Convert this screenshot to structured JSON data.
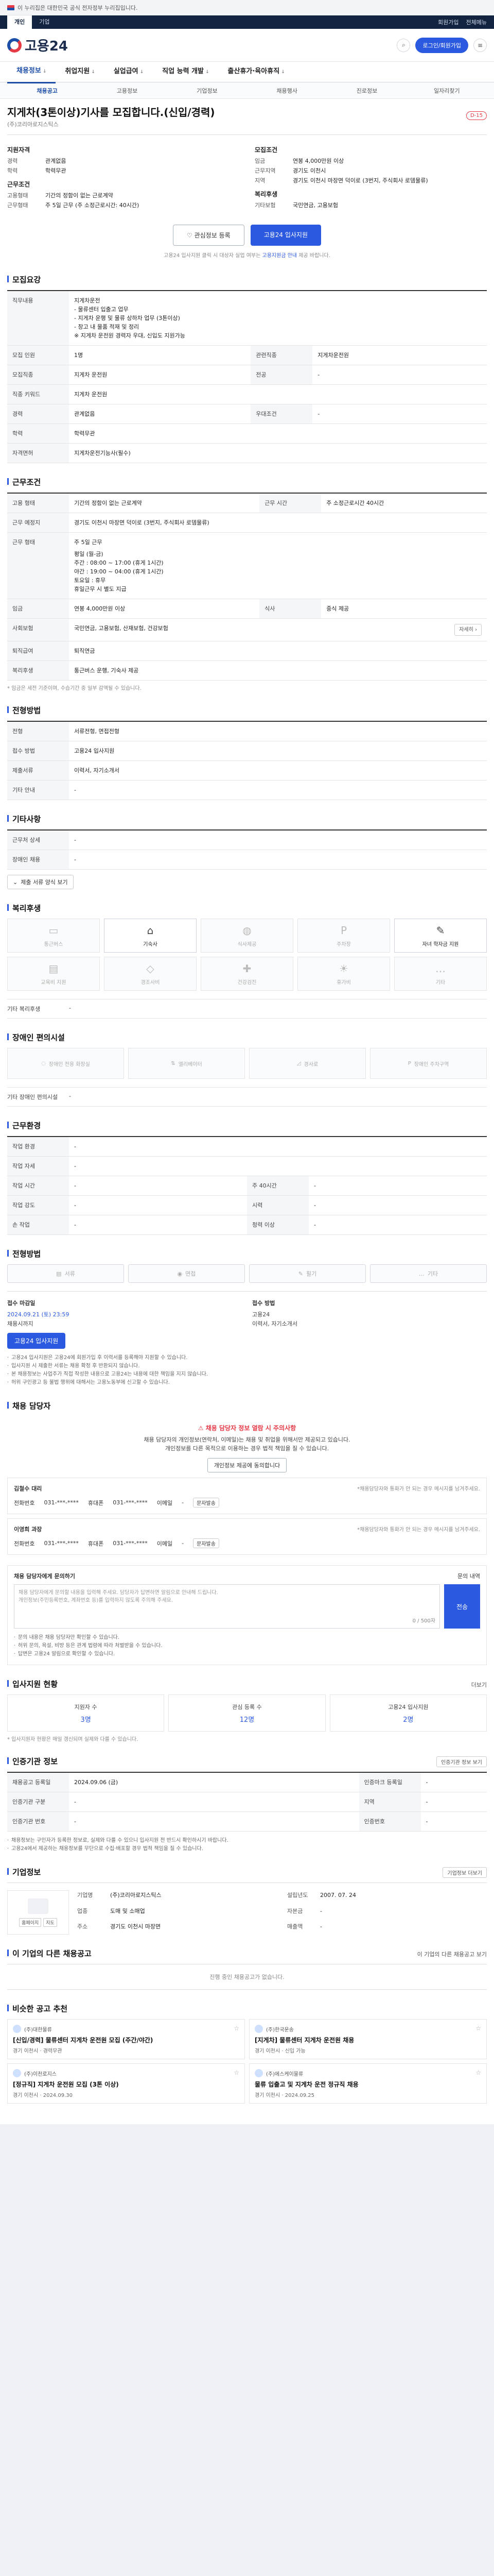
{
  "gov_banner": "이 누리집은 대한민국 공식 전자정부 누리집입니다.",
  "util": {
    "tabs": [
      "개인",
      "기업"
    ],
    "links": [
      "회원가입",
      "전체메뉴"
    ]
  },
  "header": {
    "logo": "고용24",
    "login": "로그인/회원가입"
  },
  "gnb": [
    {
      "label": "채용정보",
      "sub": "↓"
    },
    {
      "label": "취업지원",
      "sub": "↓"
    },
    {
      "label": "실업급여",
      "sub": "↓"
    },
    {
      "label": "직업 능력 개발",
      "sub": "↓"
    },
    {
      "label": "출산휴가·육아휴직",
      "sub": "↓"
    }
  ],
  "subnav": [
    "채용공고",
    "고용정보",
    "기업정보",
    "채용행사",
    "진로정보",
    "일자리찾기"
  ],
  "job": {
    "title": "지게차(3톤이상)기사를 모집합니다.(신입/경력)",
    "d_badge": "D-15",
    "company": "(주)코리아로지스틱스"
  },
  "summary": {
    "left_group1": "지원자격",
    "left": [
      {
        "k": "경력",
        "v": "관계없음"
      },
      {
        "k": "학력",
        "v": "학력무관"
      }
    ],
    "left_group2": "근무조건",
    "left2": [
      {
        "k": "고용형태",
        "v": "기간의 정함이 없는 근로계약"
      },
      {
        "k": "근무형태",
        "v": "주 5일 근무 (주 소정근로시간: 40시간)"
      }
    ],
    "right_group1": "모집조건",
    "right": [
      {
        "k": "임금",
        "v": "연봉 4,000만원 이상"
      },
      {
        "k": "근무지역",
        "v": "경기도 이천시"
      },
      {
        "k": "지역",
        "v": "경기도 이천시 마장면 덕이로 (3번지, 주식회사 로뎀물류)"
      }
    ],
    "right_group2": "복리후생",
    "right2": [
      {
        "k": "기타보험",
        "v": "국민연금, 고용보험"
      }
    ]
  },
  "actions": {
    "scrap": "관심정보 등록",
    "apply": "고용24 입사지원"
  },
  "notice": {
    "text": "고용24 입사지원 클릭 시 대상자 실업 여부는",
    "link": "고용지원금 안내",
    "text2": "제공 바랍니다."
  },
  "s_recruit": {
    "title": "모집요강",
    "rows": [
      {
        "k": "직무내용",
        "v": "지게차운전\n- 물류센터 입출고 업무\n- 지게차 운행 및 물류 상하차 업무 (3톤이상)\n- 창고 내 물품 적재 및 정리\n※ 지게차 운전원 경력자 우대, 신입도 지원가능"
      },
      {
        "k": "모집 인원",
        "v": "1명"
      },
      {
        "k": "모집직종",
        "v": "지게차 운전원"
      },
      {
        "k": "직종 키워드",
        "v": "지게차 운전원"
      },
      {
        "k": "경력",
        "v": "관계없음"
      },
      {
        "k": "학력",
        "v": "학력무관"
      },
      {
        "k": "자격면허",
        "v": "지게차운전기능사(필수)"
      }
    ],
    "side": [
      {
        "k": "관련직종",
        "v": "지게차운전원"
      },
      {
        "k": "전공",
        "v": "-"
      },
      {
        "k": "우대조건",
        "v": "-"
      }
    ]
  },
  "s_work": {
    "title": "근무조건",
    "rows": [
      {
        "k": "고용 형태",
        "v": "기간의 정함이 없는 근로계약"
      },
      {
        "k": "근무 시간",
        "v": "주 소정근로시간 40시간"
      },
      {
        "k": "근무 예정지",
        "v": "경기도 이천시 마장면 덕이로 (3번지, 주식회사 로뎀물류)"
      },
      {
        "k": "근무 형태",
        "v": "주 5일 근무"
      },
      {
        "k": "사회보험",
        "v": "국민연금, 고용보험, 산재보험, 건강보험"
      },
      {
        "k": "퇴직급여",
        "v": "퇴직연금"
      }
    ],
    "schedule": "평일 (월-금)\n주간 : 08:00 ~ 17:00 (휴게 1시간)\n야간 : 19:00 ~ 04:00 (휴게 1시간)\n토요일 : 휴무\n휴일근무 시 별도 지급",
    "wage": "연봉 4,000만원 이상",
    "meal": "중식 제공",
    "welfare": "통근버스 운행, 기숙사 제공",
    "footnote": "* 임금은 세전 기준이며, 수습기간 중 일부 감액될 수 있습니다."
  },
  "s_apply_period": {
    "title": "전형방법",
    "rows": [
      {
        "k": "전형",
        "v": "서류전형, 면접전형"
      },
      {
        "k": "접수 방법",
        "v": "고용24 입사지원"
      },
      {
        "k": "제출서류",
        "v": "이력서, 자기소개서"
      },
      {
        "k": "기타 안내",
        "v": "-"
      }
    ],
    "toggle": "제출 서류 양식 보기"
  },
  "s_etc": {
    "title": "기타사항",
    "rows": [
      {
        "k": "근무처 상세",
        "v": "-"
      },
      {
        "k": "장애인 채용",
        "v": "-"
      }
    ]
  },
  "s_welfare": {
    "title": "복리후생",
    "cells": [
      "통근버스",
      "기숙사",
      "식사제공",
      "주차장",
      "자녀 학자금 지원",
      "교육비 지원",
      "경조사비",
      "건강검진",
      "휴가비",
      "기타"
    ],
    "on_index": [
      1,
      4
    ],
    "etc_label": "기타 복리후생",
    "etc_value": "-"
  },
  "s_disabled": {
    "title": "장애인 편의시설",
    "cells": [
      "장애인 전용 화장실",
      "엘리베이터",
      "경사로",
      "장애인 주차구역"
    ],
    "etc_label": "기타 장애인 편의시설",
    "etc_value": "-"
  },
  "s_place": {
    "title": "근무환경",
    "rows": [
      {
        "k": "작업 환경",
        "v": "-",
        "k2": "",
        "v2": ""
      },
      {
        "k": "작업 자세",
        "v": "-",
        "k2": "",
        "v2": ""
      },
      {
        "k": "작업 시간",
        "v": "-",
        "k2": "주 40시간",
        "v2": "-"
      },
      {
        "k": "작업 강도",
        "v": "-",
        "k2": "시력",
        "v2": "-"
      },
      {
        "k": "손 작업",
        "v": "-",
        "k2": "청력 이상",
        "v2": "-"
      }
    ]
  },
  "s_method": {
    "title": "전형방법",
    "btns": [
      "서류",
      "면접",
      "필기",
      "기타"
    ],
    "cols": [
      {
        "k": "접수 마감일",
        "v": "2024.09.21 (토) 23:59",
        "s": "채용시까지"
      },
      {
        "k": "접수 방법",
        "v": "고용24",
        "s": "이력서, 자기소개서"
      }
    ],
    "btn": "고용24 입사지원",
    "bullets": [
      "고용24 입사지원은 고용24에 회원가입 후 이력서를 등록해야 지원할 수 있습니다.",
      "입사지원 시 제출한 서류는 채용 확정 후 반환되지 않습니다.",
      "본 채용정보는 사업주가 직접 작성한 내용으로 고용24는 내용에 대한 책임을 지지 않습니다.",
      "허위 구인광고 등 불법 행위에 대해서는 고용노동부에 신고할 수 있습니다."
    ]
  },
  "s_contact": {
    "title": "채용 담당자",
    "warn": "채용 담당자 정보 열람 시 주의사항",
    "text": "채용 담당자의 개인정보(연락처, 이메일)는 채용 및 취업을 위해서만 제공되고 있습니다.\n개인정보를 다른 목적으로 이용하는 경우 법적 책임을 질 수 있습니다.",
    "btn": "개인정보 제공에 동의합니다",
    "people": [
      {
        "name": "김철수 대리",
        "sub": "*채용담당자와 통화가 안 되는 경우 메시지를 남겨주세요.",
        "phone": "031-***-****",
        "tel_label": "휴대폰",
        "fax": "031-***-****",
        "mail_label": "이메일",
        "mail": "-",
        "pill": "문자발송"
      },
      {
        "name": "이영희 과장",
        "sub": "*채용담당자와 통화가 안 되는 경우 메시지를 남겨주세요.",
        "phone": "031-***-****",
        "tel_label": "휴대폰",
        "fax": "031-***-****",
        "mail_label": "이메일",
        "mail": "-",
        "pill": "문자발송"
      }
    ]
  },
  "s_inquiry": {
    "label": "채용 담당자에게 문의하기",
    "more": "문의 내역",
    "placeholder": "채용 담당자에게 문의할 내용을 입력해 주세요. 담당자가 답변하면 알림으로 안내해 드립니다.\n개인정보(주민등록번호, 계좌번호 등)를 입력하지 않도록 주의해 주세요.",
    "count": "0 / 500자",
    "send": "전송",
    "bullets": [
      "문의 내용은 채용 담당자만 확인할 수 있습니다.",
      "허위 문의, 욕설, 비방 등은 관계 법령에 따라 처벌받을 수 있습니다.",
      "답변은 고용24 알림으로 확인할 수 있습니다."
    ]
  },
  "s_applicant": {
    "title": "입사지원 현황",
    "more": "더보기",
    "cells": [
      {
        "l": "지원자 수",
        "v": "3명"
      },
      {
        "l": "관심 등록 수",
        "v": "12명"
      },
      {
        "l": "고용24 입사지원",
        "v": "2명"
      }
    ],
    "note": "* 입사지원자 현황은 매일 갱신되며 실제와 다를 수 있습니다."
  },
  "s_info": {
    "title": "인증기관 정보",
    "btn": "인증기관 정보 보기",
    "rows": [
      {
        "k": "채용공고 등록일",
        "v": "2024.09.06 (금)",
        "k2": "인증마크 등록일",
        "v2": "-"
      },
      {
        "k": "인증기관 구분",
        "v": "-",
        "k2": "지역",
        "v2": "-"
      },
      {
        "k": "인증기관 번호",
        "v": "-",
        "k2": "인증번호",
        "v2": "-"
      }
    ],
    "bullets": [
      "채용정보는 구인자가 등록한 정보로, 실제와 다를 수 있으니 입사지원 전 반드시 확인하시기 바랍니다.",
      "고용24에서 제공하는 채용정보를 무단으로 수집·배포할 경우 법적 책임을 질 수 있습니다."
    ]
  },
  "s_company": {
    "title": "기업정보",
    "more": "기업정보 더보기",
    "mini": [
      "홈페이지",
      "지도"
    ],
    "kvs": [
      {
        "k": "기업명",
        "v": "(주)코리아로지스틱스"
      },
      {
        "k": "설립년도",
        "v": "2007. 07. 24"
      },
      {
        "k": "업종",
        "v": "도매 및 소매업"
      },
      {
        "k": "자본금",
        "v": "-"
      },
      {
        "k": "주소",
        "v": "경기도 이천시 마장면"
      },
      {
        "k": "매출액",
        "v": "-"
      }
    ]
  },
  "s_other": {
    "title": "이 기업의 다른 채용공고",
    "more": "이 기업의 다른 채용공고 보기",
    "empty": "진행 중인 채용공고가 없습니다."
  },
  "s_similar": {
    "title": "비슷한 공고 추천",
    "items": [
      {
        "co": "(주)대한물류",
        "title": "[신입/경력] 물류센터 지게차 운전원 모집 (주간/야간)",
        "meta": "경기 이천시 · 경력무관"
      },
      {
        "co": "(주)한국운송",
        "title": "[지게차] 물류센터 지게차 운전원 채용",
        "meta": "경기 이천시 · 신입 가능"
      },
      {
        "co": "(주)이천로지스",
        "title": "[정규직] 지게차 운전원 모집 (3톤 이상)",
        "meta": "경기 이천시 · 2024.09.30"
      },
      {
        "co": "(주)에스케이물류",
        "title": "물류 입출고 및 지게차 운전 정규직 채용",
        "meta": "경기 이천시 · 2024.09.25"
      }
    ]
  }
}
